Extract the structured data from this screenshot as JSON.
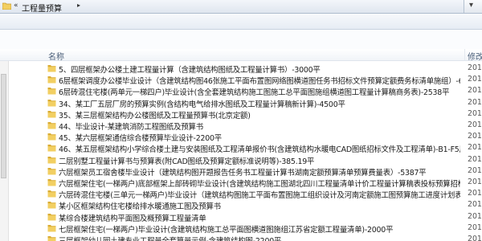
{
  "address_bar": {
    "separator": "«",
    "path": "工程量预算",
    "arrow": "▸",
    "end_glyph": "▾"
  },
  "columns": {
    "name": "名称",
    "modified": "修改日期"
  },
  "files": [
    {
      "name": "5、四层框架办公楼土建工程量计算（含建筑结构图纸及工程量计算书）-3000平",
      "date": "2016"
    },
    {
      "name": "6层框架调度办公楼毕业设计（含建筑结构图46张施工平面布置图网络图横道图任务书招标文件预算定额费务标清单施组）-6060.39平",
      "date": "2016"
    },
    {
      "name": "6层砖混住宅楼(两单元一梯四户)毕业设计(含全套建筑结构施工图施工总平面图施组横道图工程量计算稿商务表)-2538平",
      "date": "2016"
    },
    {
      "name": "34、某工厂五层厂房的预算实例(含结构电气给排水图纸及工程量计算稿新计算)-4500平",
      "date": "2016"
    },
    {
      "name": "35、某三层框架结构办公楼图纸及工程量预算书(北京定额)",
      "date": "2016"
    },
    {
      "name": "44、毕业设计-某建筑消防工程图纸及预算书",
      "date": "2016"
    },
    {
      "name": "45、某六层框架通信综合楼预算毕业设计-2200平",
      "date": "2016"
    },
    {
      "name": "46、某五层框架结构小学综合楼土建与安装图纸及工程清单报价书(含建筑结构水暖电CAD图纸招标文件及工程清单)-B1-F5层3200平",
      "date": "2016"
    },
    {
      "name": "二层别墅工程量计算书与预算表(附CAD图纸及预算定额标准说明等)-385.19平",
      "date": "2016"
    },
    {
      "name": "六层框架员工宿舍楼毕业设计（建筑结构图开题报告任务书工程量计算书湖南定额预算清单预算费量表）-5387平",
      "date": "2016"
    },
    {
      "name": "六层框架住宅(一梯两户)底部框架上部砖砌毕业设计(含建筑结构施工图湖北四川工程量清单计价工程量计算稿表投标预算招标价)-1257平",
      "date": "2016"
    },
    {
      "name": "六层砖混住宅楼(三单元一梯两户)毕业设计（建筑结构图施工平面布置图施工组织设计及河南定额施工图预算施工进度计划表）-3381.54平",
      "date": "2016"
    },
    {
      "name": "某小区框架结构住宅楼给排水暖通施工图及预算书",
      "date": "2016"
    },
    {
      "name": "某综合楼建筑结构平面图及概预算工程量清单",
      "date": "2016"
    },
    {
      "name": "七层框架住宅(一梯两户)毕业设计(含建筑结构施工总平面图横道图施组江苏省定额工程量清单)-2000平",
      "date": "2016"
    },
    {
      "name": "三层框架幼儿园土建专业工程量全套算量示例-含建筑结构图-2200平",
      "date": "2016"
    }
  ],
  "colors": {
    "folder_fill": "#f2cf62",
    "folder_dark": "#d9ac34",
    "header_text": "#4c607a"
  },
  "icons": {
    "folder": "folder-icon",
    "chevron": "chevron-down-icon"
  }
}
